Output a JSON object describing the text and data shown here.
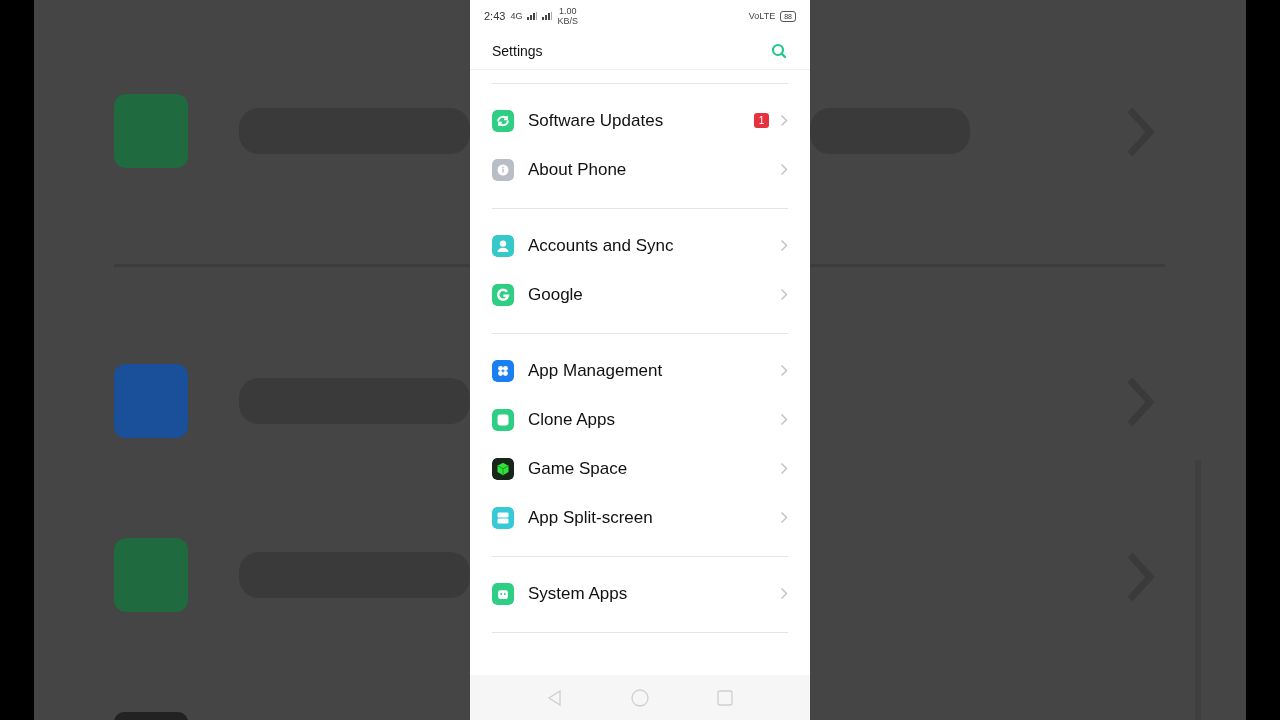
{
  "status_bar": {
    "time": "2:43",
    "network": "4G",
    "speed_value": "1.00",
    "speed_unit": "KB/S",
    "volte": "VoLTE",
    "battery": "88"
  },
  "header": {
    "title": "Settings"
  },
  "groups": [
    {
      "items": [
        {
          "label": "Software Updates",
          "kind": "sync",
          "color": "#2ecf85",
          "badge": "1"
        },
        {
          "label": "About Phone",
          "kind": "info",
          "color": "#b9bec6"
        }
      ]
    },
    {
      "items": [
        {
          "label": "Accounts and Sync",
          "kind": "person",
          "color": "#36c9c9"
        },
        {
          "label": "Google",
          "kind": "g",
          "color": "#2ecf85"
        }
      ]
    },
    {
      "items": [
        {
          "label": "App Management",
          "kind": "grid",
          "color": "#1a7ff0"
        },
        {
          "label": "Clone Apps",
          "kind": "square",
          "color": "#2ecf85"
        },
        {
          "label": "Game Space",
          "kind": "cube",
          "color": "#18261a"
        },
        {
          "label": "App Split-screen",
          "kind": "split",
          "color": "#36c9d6"
        }
      ]
    },
    {
      "items": [
        {
          "label": "System Apps",
          "kind": "robot",
          "color": "#2ecf85"
        }
      ]
    }
  ]
}
